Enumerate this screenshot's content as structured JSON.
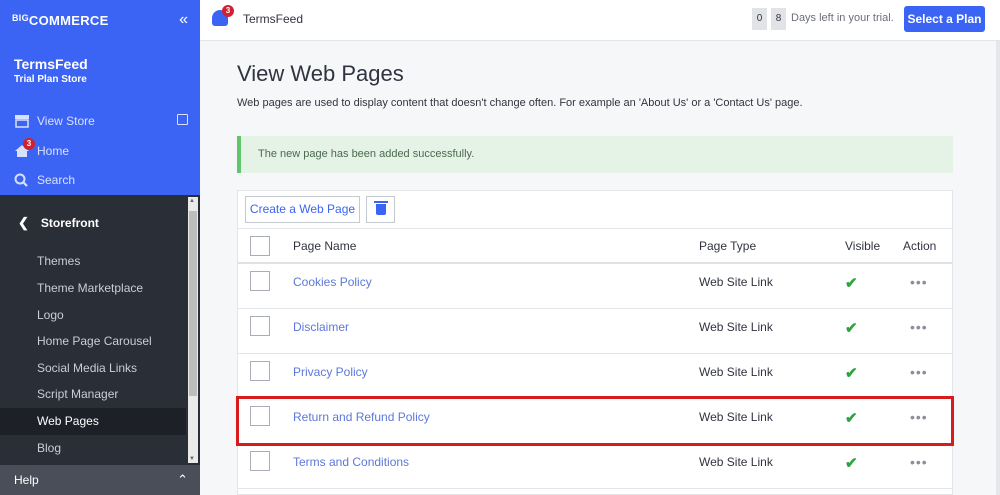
{
  "sidebar": {
    "logo_big": "BIG",
    "logo_commerce": "COMMERCE",
    "collapse_glyph": "«",
    "store_name": "TermsFeed",
    "store_plan": "Trial Plan Store",
    "view_store": "View Store",
    "home": "Home",
    "home_badge": "3",
    "search": "Search",
    "section": "Storefront",
    "items": [
      {
        "label": "Themes"
      },
      {
        "label": "Theme Marketplace"
      },
      {
        "label": "Logo"
      },
      {
        "label": "Home Page Carousel"
      },
      {
        "label": "Social Media Links"
      },
      {
        "label": "Script Manager"
      },
      {
        "label": "Web Pages"
      },
      {
        "label": "Blog"
      }
    ],
    "active_item": "Web Pages",
    "help": "Help"
  },
  "topbar": {
    "notification_badge": "3",
    "store": "TermsFeed",
    "trial_digit_1": "0",
    "trial_digit_2": "8",
    "trial_text": "Days left in your trial.",
    "plan_button": "Select a Plan"
  },
  "main": {
    "title": "View Web Pages",
    "description": "Web pages are used to display content that doesn't change often. For example an 'About Us' or a 'Contact Us' page.",
    "alert": "The new page has been added successfully.",
    "create_button": "Create a Web Page",
    "columns": {
      "name": "Page Name",
      "type": "Page Type",
      "visible": "Visible",
      "action": "Action"
    },
    "rows": [
      {
        "name": "Cookies Policy",
        "type": "Web Site Link",
        "visible": "✔",
        "action": "•••"
      },
      {
        "name": "Disclaimer",
        "type": "Web Site Link",
        "visible": "✔",
        "action": "•••"
      },
      {
        "name": "Privacy Policy",
        "type": "Web Site Link",
        "visible": "✔",
        "action": "•••"
      },
      {
        "name": "Return and Refund Policy",
        "type": "Web Site Link",
        "visible": "✔",
        "action": "•••"
      },
      {
        "name": "Terms and Conditions",
        "type": "Web Site Link",
        "visible": "✔",
        "action": "•••"
      }
    ]
  },
  "colors": {
    "brand_blue": "#3c64f4",
    "sidebar_dark": "#2a2e37",
    "success_green": "#60c66b",
    "highlight_red": "#d81b1b"
  }
}
